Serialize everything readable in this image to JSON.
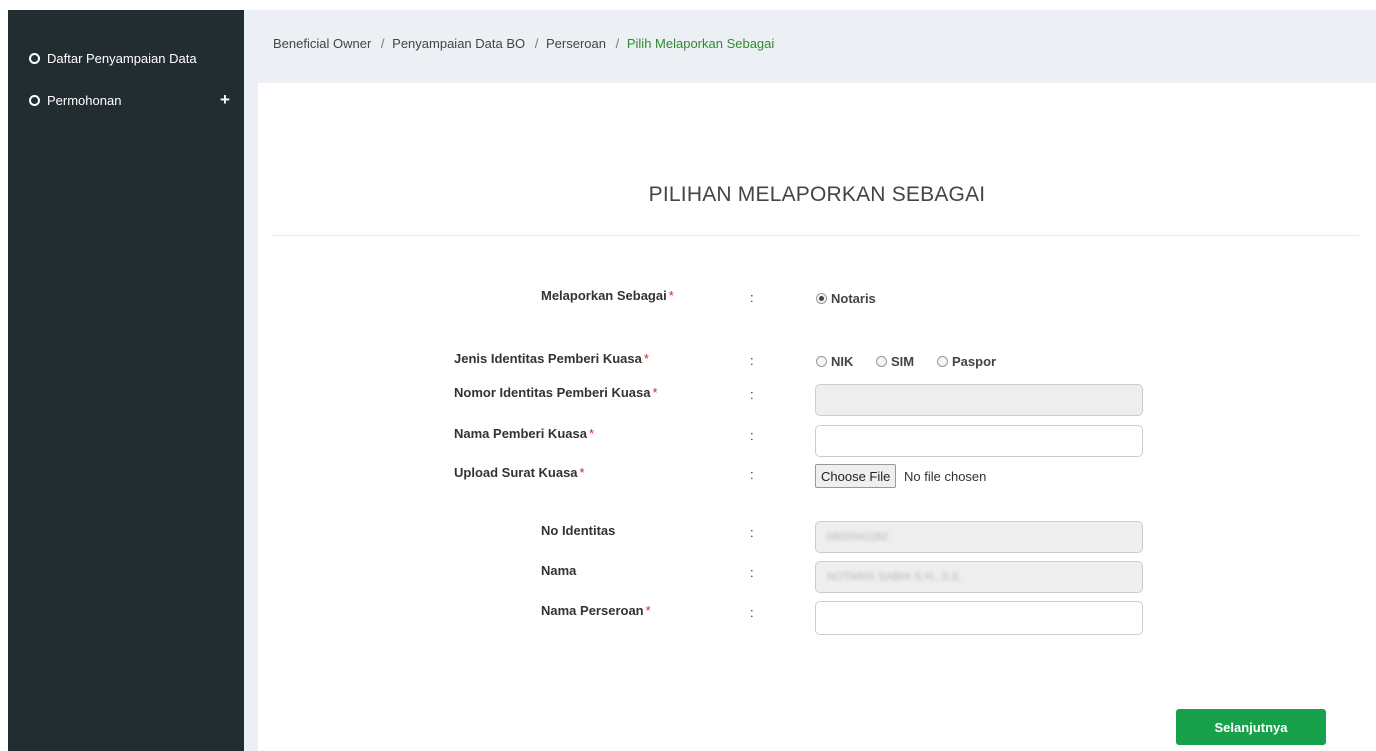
{
  "sidebar": {
    "items": [
      {
        "label": "Daftar Penyampaian Data"
      },
      {
        "label": "Permohonan",
        "expand": "+"
      }
    ]
  },
  "breadcrumb": {
    "items": [
      "Beneficial Owner",
      "Penyampaian Data BO",
      "Perseroan",
      "Pilih Melaporkan Sebagai"
    ],
    "separator": "/",
    "active_color": "#2e8b2e"
  },
  "form": {
    "title": "PILIHAN MELAPORKAN SEBAGAI",
    "colon": ":",
    "required_mark": "*",
    "melaporkan_sebagai": {
      "label": "Melaporkan Sebagai",
      "option": "Notaris",
      "selected": true
    },
    "jenis_identitas": {
      "label": "Jenis Identitas Pemberi Kuasa",
      "options": [
        "NIK",
        "SIM",
        "Paspor"
      ]
    },
    "nomor_identitas": {
      "label": "Nomor Identitas Pemberi Kuasa",
      "value": ""
    },
    "nama_pemberi": {
      "label": "Nama Pemberi Kuasa",
      "value": ""
    },
    "upload": {
      "label": "Upload Surat Kuasa",
      "button": "Choose File",
      "status": "No file chosen"
    },
    "no_identitas": {
      "label": "No Identitas",
      "value": "0920041282"
    },
    "nama": {
      "label": "Nama",
      "value": "NOTARIS SABHI S.H., S.E."
    },
    "nama_perseroan": {
      "label": "Nama Perseroan",
      "value": ""
    },
    "next_button": "Selanjutnya"
  },
  "colors": {
    "sidebar": "#222d32",
    "background": "#ecf0f5",
    "primary_button": "#17a14b",
    "required": "#dd2222"
  }
}
